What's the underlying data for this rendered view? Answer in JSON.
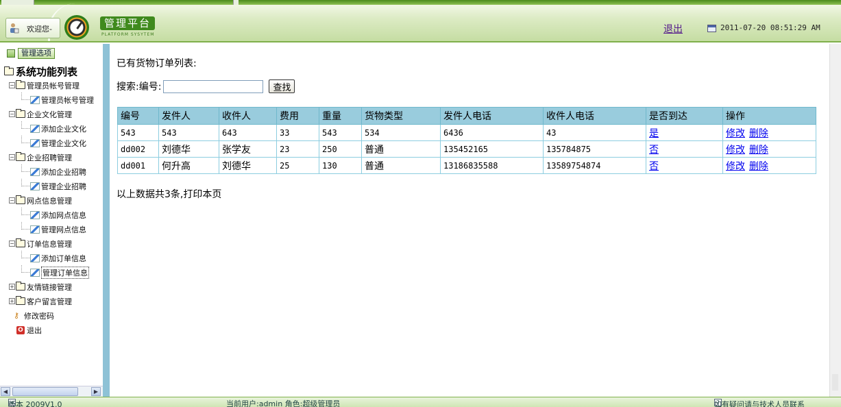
{
  "header": {
    "welcome": "欢迎您-",
    "brand_title": "管理平台",
    "brand_subtitle": "PLATFORM SYSYTEM",
    "logout": "退出",
    "datetime": "2011-07-20 08:51:29 AM"
  },
  "sidebar": {
    "options_button": "管理选项",
    "title": "系统功能列表",
    "items": [
      {
        "label": "管理员帐号管理",
        "type": "group",
        "expanded": true
      },
      {
        "label": "管理员帐号管理",
        "type": "leaf"
      },
      {
        "label": "企业文化管理",
        "type": "group",
        "expanded": true
      },
      {
        "label": "添加企业文化",
        "type": "leaf"
      },
      {
        "label": "管理企业文化",
        "type": "leaf"
      },
      {
        "label": "企业招聘管理",
        "type": "group",
        "expanded": true
      },
      {
        "label": "添加企业招聘",
        "type": "leaf"
      },
      {
        "label": "管理企业招聘",
        "type": "leaf"
      },
      {
        "label": "网点信息管理",
        "type": "group",
        "expanded": true
      },
      {
        "label": "添加网点信息",
        "type": "leaf"
      },
      {
        "label": "管理网点信息",
        "type": "leaf"
      },
      {
        "label": "订单信息管理",
        "type": "group",
        "expanded": true
      },
      {
        "label": "添加订单信息",
        "type": "leaf"
      },
      {
        "label": "管理订单信息",
        "type": "leaf",
        "selected": true
      },
      {
        "label": "友情链接管理",
        "type": "group",
        "expanded": false
      },
      {
        "label": "客户留言管理",
        "type": "group",
        "expanded": false
      },
      {
        "label": "修改密码",
        "type": "key"
      },
      {
        "label": "退出",
        "type": "exit"
      }
    ]
  },
  "main": {
    "heading": "已有货物订单列表:",
    "search_label": "搜索:编号:",
    "search_value": "",
    "search_button": "查找",
    "columns": [
      "编号",
      "发件人",
      "收件人",
      "费用",
      "重量",
      "货物类型",
      "发件人电话",
      "收件人电话",
      "是否到达",
      "操作"
    ],
    "rows": [
      {
        "id": "543",
        "sender": "543",
        "receiver": "643",
        "fee": "33",
        "weight": "543",
        "cargo_type": "534",
        "sender_phone": "6436",
        "receiver_phone": "43",
        "arrived": "是",
        "edit": "修改",
        "delete": "删除"
      },
      {
        "id": "dd002",
        "sender": "刘德华",
        "receiver": "张学友",
        "fee": "23",
        "weight": "250",
        "cargo_type": "普通",
        "sender_phone": "135452165",
        "receiver_phone": "135784875",
        "arrived": "否",
        "edit": "修改",
        "delete": "删除"
      },
      {
        "id": "dd001",
        "sender": "何升高",
        "receiver": "刘德华",
        "fee": "25",
        "weight": "130",
        "cargo_type": "普通",
        "sender_phone": "13186835588",
        "receiver_phone": "13589754874",
        "arrived": "否",
        "edit": "修改",
        "delete": "删除"
      }
    ],
    "summary": "以上数据共3条,打印本页"
  },
  "statusbar": {
    "version": "版本 2009V1.0",
    "current_user": "当前用户:admin  角色:超级管理员",
    "contact": "如有疑问请与技术人员联系"
  }
}
